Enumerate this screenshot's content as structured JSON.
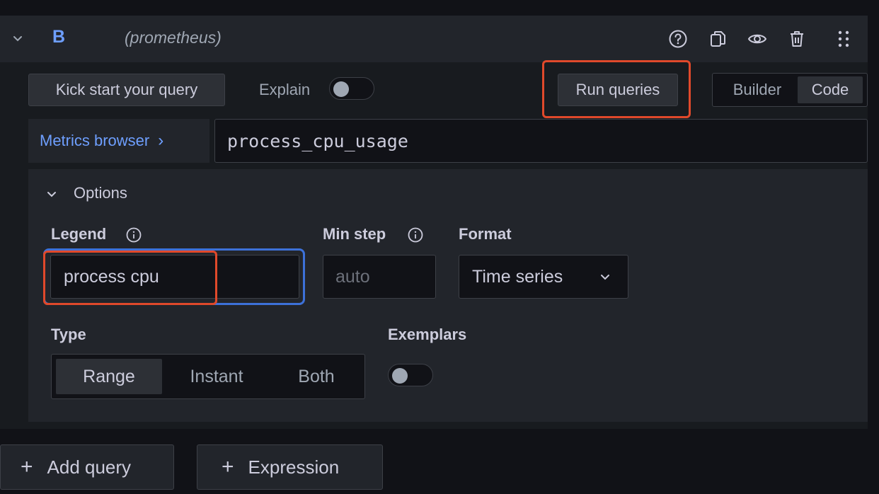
{
  "query_row": {
    "ref_id": "B",
    "datasource": "(prometheus)",
    "icons": [
      "help-icon",
      "duplicate-icon",
      "eye-icon",
      "trash-icon",
      "drag-icon"
    ]
  },
  "toolbar": {
    "kickstart_label": "Kick start your query",
    "explain_label": "Explain",
    "explain_on": false,
    "run_label": "Run queries",
    "modes": [
      "Builder",
      "Code"
    ],
    "active_mode": "Code"
  },
  "editor": {
    "metrics_browser_label": "Metrics browser",
    "metrics_browser_chevron": "›",
    "query_text": "process_cpu_usage"
  },
  "options": {
    "section_label": "Options",
    "legend_label": "Legend",
    "legend_value": "process cpu",
    "min_step_label": "Min step",
    "min_step_placeholder": "auto",
    "format_label": "Format",
    "format_value": "Time series",
    "type_label": "Type",
    "type_options": [
      "Range",
      "Instant",
      "Both"
    ],
    "type_selected": "Range",
    "exemplars_label": "Exemplars",
    "exemplars_on": false
  },
  "footer": {
    "add_query_label": "Add query",
    "expression_label": "Expression",
    "plus_glyph": "+"
  },
  "colors": {
    "accent_blue": "#6e9fff",
    "highlight_red": "#e0492b",
    "focus_blue": "#3d71d9"
  }
}
